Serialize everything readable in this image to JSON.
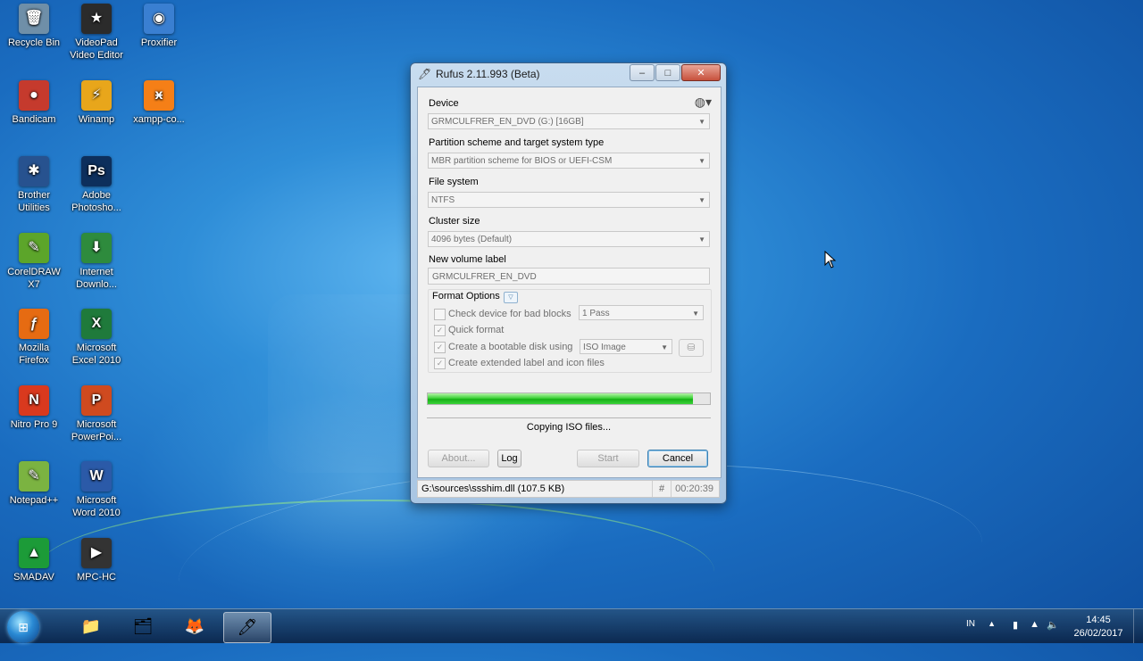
{
  "desktop": {
    "icons": [
      {
        "label": "Recycle Bin",
        "glyph": "🗑",
        "color": "#6f8fa8"
      },
      {
        "label": "VideoPad Video Editor",
        "glyph": "★",
        "color": "#2b2b2b"
      },
      {
        "label": "Proxifier",
        "glyph": "◉",
        "color": "#3a7fd1"
      },
      {
        "label": "Bandicam",
        "glyph": "●",
        "color": "#c53a2d"
      },
      {
        "label": "Winamp",
        "glyph": "⚡",
        "color": "#e8a61b"
      },
      {
        "label": "xampp-co...",
        "glyph": "ӿ",
        "color": "#f57f17"
      },
      {
        "label": "Brother Utilities",
        "glyph": "✱",
        "color": "#27528f"
      },
      {
        "label": "Adobe Photosho...",
        "glyph": "Ps",
        "color": "#0d2f5c"
      },
      {
        "label": "CorelDRAW X7",
        "glyph": "✎",
        "color": "#5ca52a"
      },
      {
        "label": "Internet Downlo...",
        "glyph": "⬇",
        "color": "#2e8b3d"
      },
      {
        "label": "Mozilla Firefox",
        "glyph": "ƒ",
        "color": "#e66b12"
      },
      {
        "label": "Microsoft Excel 2010",
        "glyph": "X",
        "color": "#1f7a3b"
      },
      {
        "label": "Nitro Pro 9",
        "glyph": "N",
        "color": "#d9391e"
      },
      {
        "label": "Microsoft PowerPoi...",
        "glyph": "P",
        "color": "#cf4a1f"
      },
      {
        "label": "Notepad++",
        "glyph": "✎",
        "color": "#7bb341"
      },
      {
        "label": "Microsoft Word 2010",
        "glyph": "W",
        "color": "#2b5aa8"
      },
      {
        "label": "SMADAV",
        "glyph": "▲",
        "color": "#1c9b38"
      },
      {
        "label": "MPC-HC",
        "glyph": "▶",
        "color": "#333333"
      }
    ]
  },
  "window": {
    "title": "Rufus 2.11.993 (Beta)",
    "controls": {
      "minimize": "‒",
      "maximize": "□",
      "close": "✕"
    },
    "device_label": "Device",
    "device_value": "GRMCULFRER_EN_DVD (G:) [16GB]",
    "partition_label": "Partition scheme and target system type",
    "partition_value": "MBR partition scheme for BIOS or UEFI-CSM",
    "filesystem_label": "File system",
    "filesystem_value": "NTFS",
    "cluster_label": "Cluster size",
    "cluster_value": "4096 bytes (Default)",
    "volume_label_label": "New volume label",
    "volume_label_value": "GRMCULFRER_EN_DVD",
    "format_options": {
      "title": "Format Options",
      "bad_blocks_label": "Check device for bad blocks",
      "bad_blocks_checked": false,
      "passes_value": "1 Pass",
      "quick_format_label": "Quick format",
      "quick_format_checked": true,
      "bootable_label": "Create a bootable disk using",
      "bootable_checked": true,
      "bootable_value": "ISO Image",
      "extended_label": "Create extended label and icon files",
      "extended_checked": true
    },
    "progress": 0.94,
    "status_text": "Copying ISO files...",
    "buttons": {
      "about": "About...",
      "log": "Log",
      "start": "Start",
      "cancel": "Cancel"
    },
    "statusbar": {
      "file": "G:\\sources\\ssshim.dll (107.5 KB)",
      "hash": "#",
      "elapsed": "00:20:39"
    }
  },
  "taskbar": {
    "items": [
      "explorer-libraries",
      "file-explorer",
      "firefox",
      "rufus"
    ],
    "tray_lang": "IN",
    "clock_time": "14:45",
    "clock_date": "26/02/2017"
  },
  "colors": {
    "progress_green": "#17b017",
    "titlebar": "#c8dcef"
  }
}
